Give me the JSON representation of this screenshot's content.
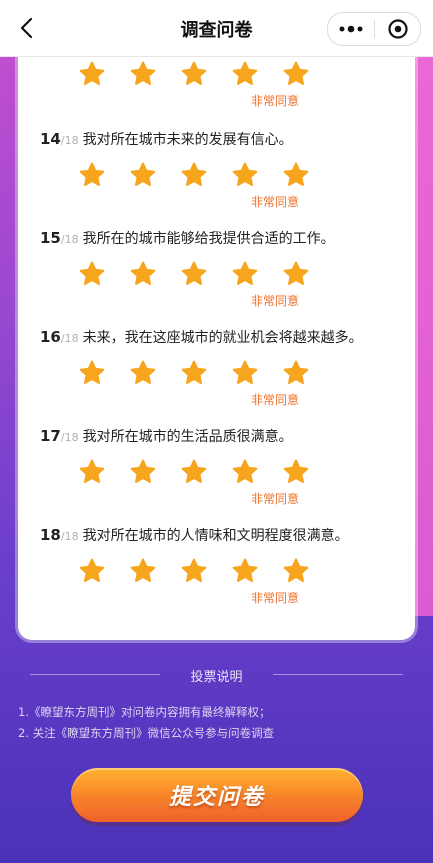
{
  "header": {
    "title": "调查问卷",
    "more_icon": "more-dots-icon",
    "close_icon": "target-circle-icon"
  },
  "colors": {
    "star": "#f7a51c",
    "agree_label": "#f0702a",
    "submit": "#f7822a"
  },
  "questions": [
    {
      "number": "",
      "total": "",
      "text": "",
      "rating": 5,
      "rating_label": "非常同意"
    },
    {
      "number": "14",
      "total": "/18",
      "text": "我对所在城市未来的发展有信心。",
      "rating": 5,
      "rating_label": "非常同意"
    },
    {
      "number": "15",
      "total": "/18",
      "text": "我所在的城市能够给我提供合适的工作。",
      "rating": 5,
      "rating_label": "非常同意"
    },
    {
      "number": "16",
      "total": "/18",
      "text": "未来，我在这座城市的就业机会将越来越多。",
      "rating": 5,
      "rating_label": "非常同意"
    },
    {
      "number": "17",
      "total": "/18",
      "text": "我对所在城市的生活品质很满意。",
      "rating": 5,
      "rating_label": "非常同意"
    },
    {
      "number": "18",
      "total": "/18",
      "text": "我对所在城市的人情味和文明程度很满意。",
      "rating": 5,
      "rating_label": "非常同意"
    }
  ],
  "notes": {
    "title": "投票说明",
    "items": [
      "1.《瞭望东方周刊》对问卷内容拥有最终解释权；",
      "2. 关注《瞭望东方周刊》微信公众号参与问卷调查"
    ]
  },
  "submit": {
    "label": "提交问卷"
  }
}
